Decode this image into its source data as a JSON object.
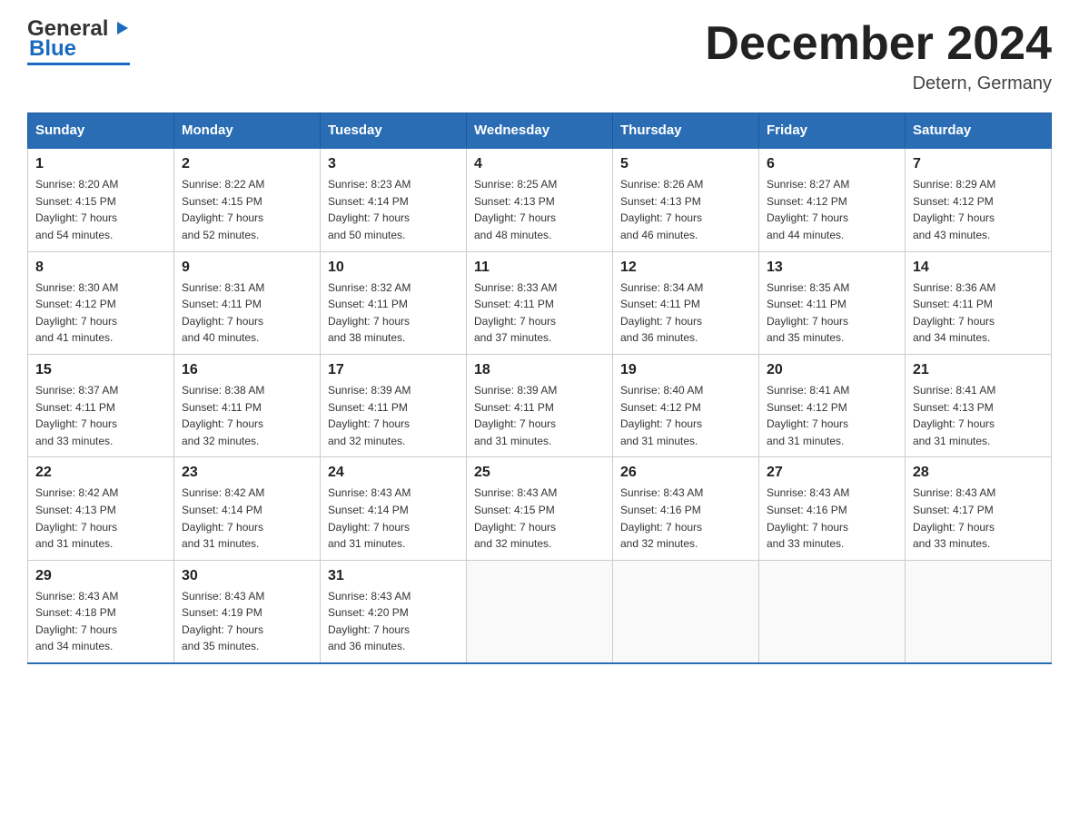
{
  "header": {
    "logo_general": "General",
    "logo_blue": "Blue",
    "month_title": "December 2024",
    "location": "Detern, Germany"
  },
  "days_of_week": [
    "Sunday",
    "Monday",
    "Tuesday",
    "Wednesday",
    "Thursday",
    "Friday",
    "Saturday"
  ],
  "weeks": [
    [
      {
        "day": "1",
        "sunrise": "8:20 AM",
        "sunset": "4:15 PM",
        "daylight": "7 hours and 54 minutes."
      },
      {
        "day": "2",
        "sunrise": "8:22 AM",
        "sunset": "4:15 PM",
        "daylight": "7 hours and 52 minutes."
      },
      {
        "day": "3",
        "sunrise": "8:23 AM",
        "sunset": "4:14 PM",
        "daylight": "7 hours and 50 minutes."
      },
      {
        "day": "4",
        "sunrise": "8:25 AM",
        "sunset": "4:13 PM",
        "daylight": "7 hours and 48 minutes."
      },
      {
        "day": "5",
        "sunrise": "8:26 AM",
        "sunset": "4:13 PM",
        "daylight": "7 hours and 46 minutes."
      },
      {
        "day": "6",
        "sunrise": "8:27 AM",
        "sunset": "4:12 PM",
        "daylight": "7 hours and 44 minutes."
      },
      {
        "day": "7",
        "sunrise": "8:29 AM",
        "sunset": "4:12 PM",
        "daylight": "7 hours and 43 minutes."
      }
    ],
    [
      {
        "day": "8",
        "sunrise": "8:30 AM",
        "sunset": "4:12 PM",
        "daylight": "7 hours and 41 minutes."
      },
      {
        "day": "9",
        "sunrise": "8:31 AM",
        "sunset": "4:11 PM",
        "daylight": "7 hours and 40 minutes."
      },
      {
        "day": "10",
        "sunrise": "8:32 AM",
        "sunset": "4:11 PM",
        "daylight": "7 hours and 38 minutes."
      },
      {
        "day": "11",
        "sunrise": "8:33 AM",
        "sunset": "4:11 PM",
        "daylight": "7 hours and 37 minutes."
      },
      {
        "day": "12",
        "sunrise": "8:34 AM",
        "sunset": "4:11 PM",
        "daylight": "7 hours and 36 minutes."
      },
      {
        "day": "13",
        "sunrise": "8:35 AM",
        "sunset": "4:11 PM",
        "daylight": "7 hours and 35 minutes."
      },
      {
        "day": "14",
        "sunrise": "8:36 AM",
        "sunset": "4:11 PM",
        "daylight": "7 hours and 34 minutes."
      }
    ],
    [
      {
        "day": "15",
        "sunrise": "8:37 AM",
        "sunset": "4:11 PM",
        "daylight": "7 hours and 33 minutes."
      },
      {
        "day": "16",
        "sunrise": "8:38 AM",
        "sunset": "4:11 PM",
        "daylight": "7 hours and 32 minutes."
      },
      {
        "day": "17",
        "sunrise": "8:39 AM",
        "sunset": "4:11 PM",
        "daylight": "7 hours and 32 minutes."
      },
      {
        "day": "18",
        "sunrise": "8:39 AM",
        "sunset": "4:11 PM",
        "daylight": "7 hours and 31 minutes."
      },
      {
        "day": "19",
        "sunrise": "8:40 AM",
        "sunset": "4:12 PM",
        "daylight": "7 hours and 31 minutes."
      },
      {
        "day": "20",
        "sunrise": "8:41 AM",
        "sunset": "4:12 PM",
        "daylight": "7 hours and 31 minutes."
      },
      {
        "day": "21",
        "sunrise": "8:41 AM",
        "sunset": "4:13 PM",
        "daylight": "7 hours and 31 minutes."
      }
    ],
    [
      {
        "day": "22",
        "sunrise": "8:42 AM",
        "sunset": "4:13 PM",
        "daylight": "7 hours and 31 minutes."
      },
      {
        "day": "23",
        "sunrise": "8:42 AM",
        "sunset": "4:14 PM",
        "daylight": "7 hours and 31 minutes."
      },
      {
        "day": "24",
        "sunrise": "8:43 AM",
        "sunset": "4:14 PM",
        "daylight": "7 hours and 31 minutes."
      },
      {
        "day": "25",
        "sunrise": "8:43 AM",
        "sunset": "4:15 PM",
        "daylight": "7 hours and 32 minutes."
      },
      {
        "day": "26",
        "sunrise": "8:43 AM",
        "sunset": "4:16 PM",
        "daylight": "7 hours and 32 minutes."
      },
      {
        "day": "27",
        "sunrise": "8:43 AM",
        "sunset": "4:16 PM",
        "daylight": "7 hours and 33 minutes."
      },
      {
        "day": "28",
        "sunrise": "8:43 AM",
        "sunset": "4:17 PM",
        "daylight": "7 hours and 33 minutes."
      }
    ],
    [
      {
        "day": "29",
        "sunrise": "8:43 AM",
        "sunset": "4:18 PM",
        "daylight": "7 hours and 34 minutes."
      },
      {
        "day": "30",
        "sunrise": "8:43 AM",
        "sunset": "4:19 PM",
        "daylight": "7 hours and 35 minutes."
      },
      {
        "day": "31",
        "sunrise": "8:43 AM",
        "sunset": "4:20 PM",
        "daylight": "7 hours and 36 minutes."
      },
      null,
      null,
      null,
      null
    ]
  ],
  "labels": {
    "sunrise": "Sunrise:",
    "sunset": "Sunset:",
    "daylight": "Daylight:"
  }
}
